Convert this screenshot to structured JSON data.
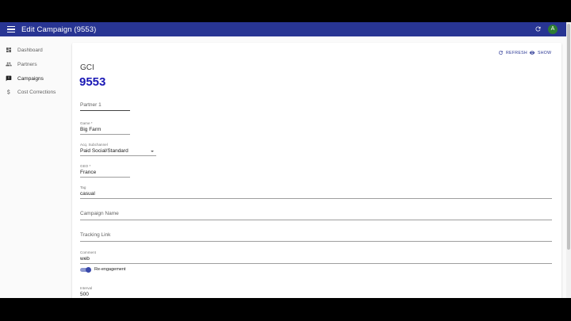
{
  "app": {
    "title": "Edit Campaign (9553)",
    "avatar_letter": "A"
  },
  "sidebar": {
    "items": [
      {
        "label": "Dashboard",
        "icon": "dashboard-icon"
      },
      {
        "label": "Partners",
        "icon": "people-icon"
      },
      {
        "label": "Campaigns",
        "icon": "campaigns-icon",
        "active": true
      },
      {
        "label": "Cost Corrections",
        "icon": "dollar-icon"
      }
    ]
  },
  "toolbar": {
    "refresh_label": "REFRESH",
    "show_label": "SHOW"
  },
  "record": {
    "subtitle": "GCI",
    "id": "9553"
  },
  "form": {
    "partner": {
      "placeholder": "Partner 1"
    },
    "game": {
      "label": "Game *",
      "value": "Big Farm"
    },
    "acq_subchannel": {
      "label": "Acq. Subchannel",
      "value": "Paid Social/Standard"
    },
    "geo": {
      "label": "GEO *",
      "value": "France"
    },
    "tag": {
      "label": "Tag",
      "value": "casual"
    },
    "campaign_name": {
      "placeholder": "Campaign Name"
    },
    "tracking_link": {
      "placeholder": "Tracking Link"
    },
    "comment": {
      "label": "Comment",
      "value": "web"
    },
    "reengagement": {
      "label": "Re-engagement",
      "checked": true
    },
    "interval": {
      "label": "Interval",
      "value": "500"
    }
  },
  "colors": {
    "appbar": "#283593",
    "id_text": "#1a18b5",
    "avatar": "#2e7d32",
    "toggle": "#3949ab"
  }
}
